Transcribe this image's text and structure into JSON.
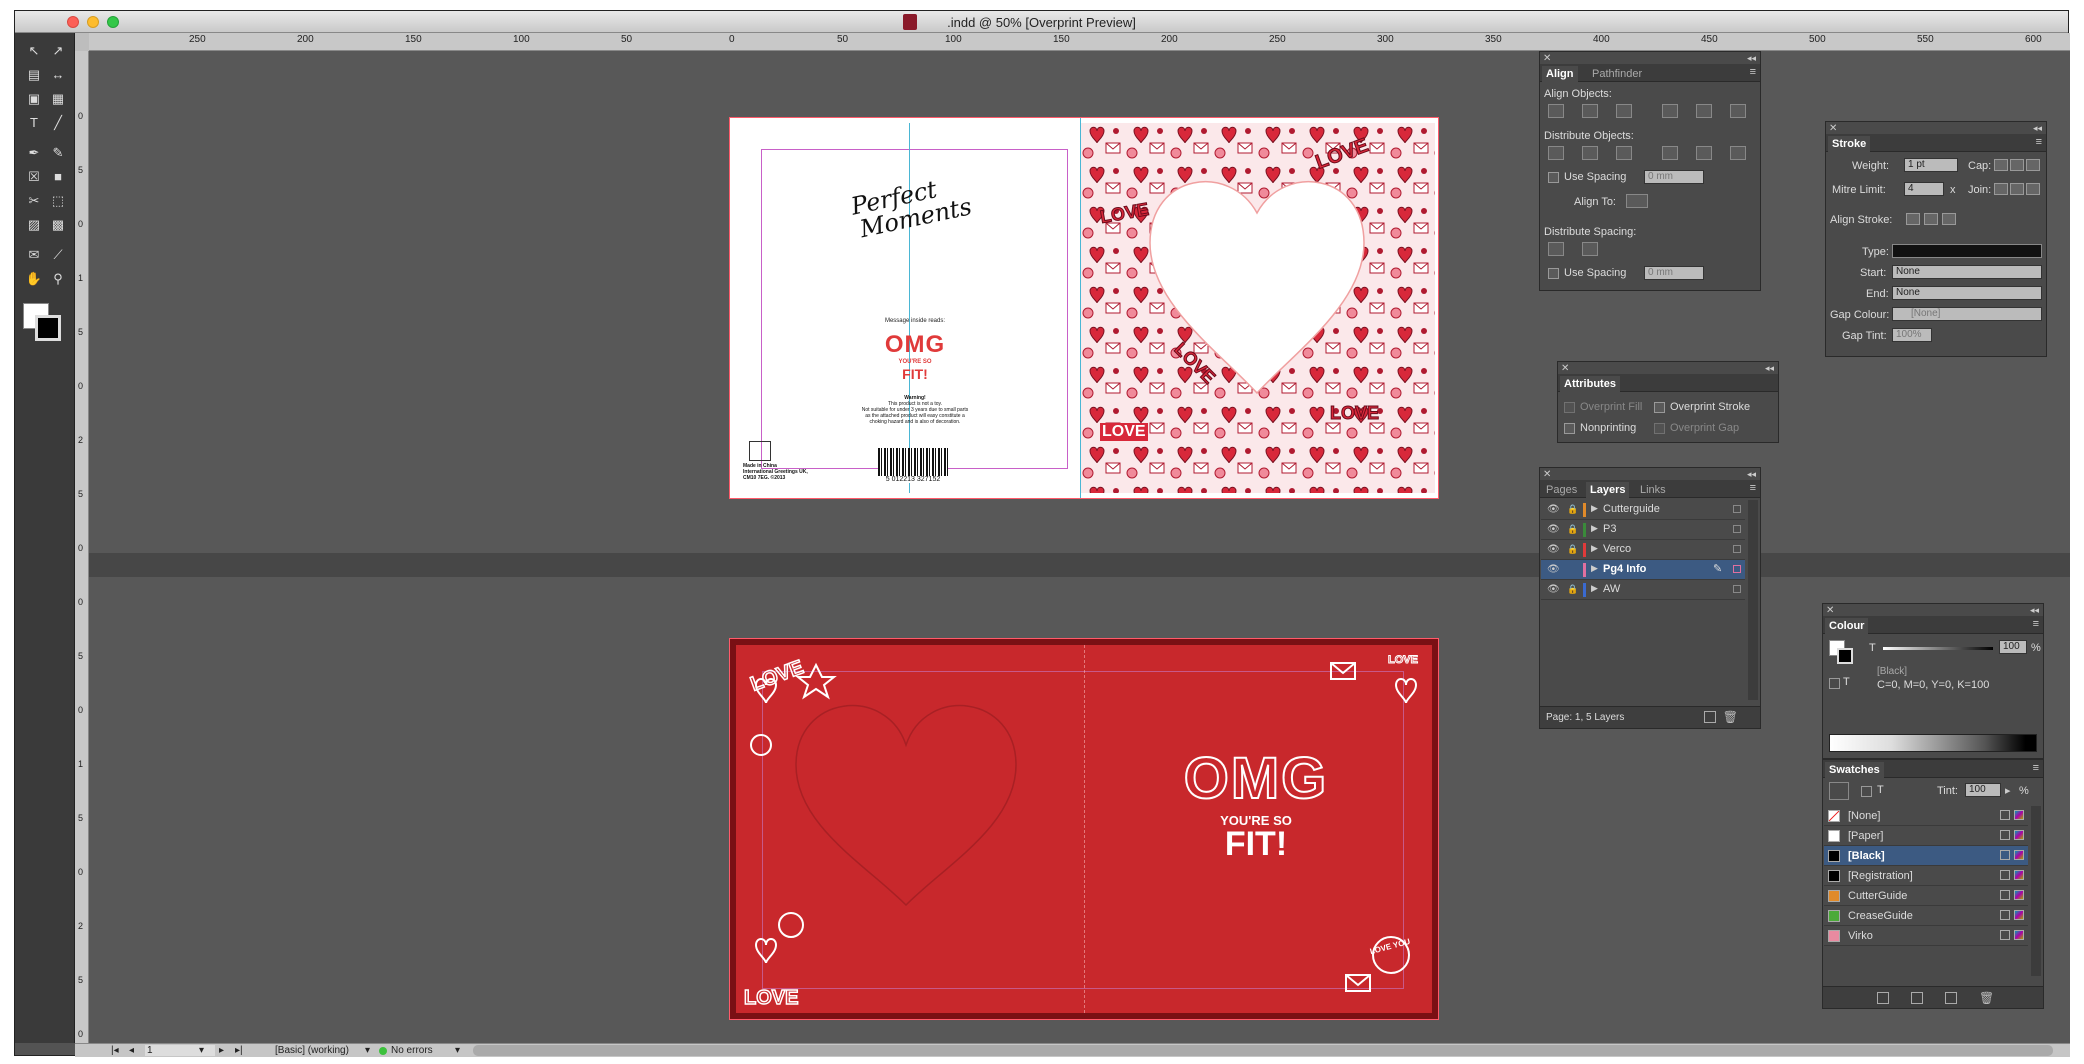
{
  "window": {
    "title": ".indd @ 50% [Overprint Preview]"
  },
  "ruler": {
    "top_ticks": [
      "250",
      "200",
      "150",
      "100",
      "50",
      "0",
      "50",
      "100",
      "150",
      "200",
      "250",
      "300",
      "350",
      "400",
      "450",
      "500",
      "550",
      "600"
    ],
    "left_ticks": [
      "0",
      "5",
      "0",
      "1",
      "5",
      "0",
      "2",
      "5",
      "0",
      "0",
      "5",
      "0",
      "1",
      "5",
      "0",
      "2",
      "5",
      "0"
    ]
  },
  "toolbox": {
    "tools": [
      {
        "name": "selection-tool-icon",
        "glyph": "↖"
      },
      {
        "name": "direct-selection-tool-icon",
        "glyph": "↗"
      },
      {
        "name": "page-tool-icon",
        "glyph": "▤"
      },
      {
        "name": "gap-tool-icon",
        "glyph": "↔"
      },
      {
        "name": "content-collector-icon",
        "glyph": "▣"
      },
      {
        "name": "content-placer-icon",
        "glyph": "▦"
      },
      {
        "name": "type-tool-icon",
        "glyph": "T"
      },
      {
        "name": "line-tool-icon",
        "glyph": "╱"
      },
      {
        "name": "pen-tool-icon",
        "glyph": "✒"
      },
      {
        "name": "pencil-tool-icon",
        "glyph": "✎"
      },
      {
        "name": "rectangle-frame-tool-icon",
        "glyph": "☒"
      },
      {
        "name": "rectangle-tool-icon",
        "glyph": "■"
      },
      {
        "name": "scissors-tool-icon",
        "glyph": "✂"
      },
      {
        "name": "free-transform-tool-icon",
        "glyph": "⬚"
      },
      {
        "name": "gradient-swatch-tool-icon",
        "glyph": "▨"
      },
      {
        "name": "gradient-feather-tool-icon",
        "glyph": "▩"
      },
      {
        "name": "note-tool-icon",
        "glyph": "✉"
      },
      {
        "name": "eyedropper-tool-icon",
        "glyph": "⟋"
      },
      {
        "name": "hand-tool-icon",
        "glyph": "✋"
      },
      {
        "name": "zoom-tool-icon",
        "glyph": "⚲"
      }
    ]
  },
  "statusbar": {
    "page": "1",
    "preflight_profile": "[Basic] (working)",
    "errors": "No errors"
  },
  "align_panel": {
    "tabs": [
      "Align",
      "Pathfinder"
    ],
    "align_objects": "Align Objects:",
    "distribute_objects": "Distribute Objects:",
    "use_spacing": "Use Spacing",
    "spacing_value": "0 mm",
    "align_to": "Align To:",
    "distribute_spacing": "Distribute Spacing:",
    "use_spacing2": "Use Spacing",
    "spacing_value2": "0 mm"
  },
  "stroke_panel": {
    "title": "Stroke",
    "weight_label": "Weight:",
    "weight_value": "1 pt",
    "cap_label": "Cap:",
    "mitre_label": "Mitre Limit:",
    "mitre_value": "4",
    "mitre_x": "x",
    "join_label": "Join:",
    "align_stroke": "Align Stroke:",
    "type_label": "Type:",
    "start_label": "Start:",
    "start_value": "None",
    "end_label": "End:",
    "end_value": "None",
    "gap_colour_label": "Gap Colour:",
    "gap_colour_value": "[None]",
    "gap_tint_label": "Gap Tint:",
    "gap_tint_value": "100%"
  },
  "attributes_panel": {
    "title": "Attributes",
    "overprint_fill": "Overprint Fill",
    "overprint_stroke": "Overprint Stroke",
    "nonprinting": "Nonprinting",
    "overprint_gap": "Overprint Gap"
  },
  "layers_panel": {
    "tabs": [
      "Pages",
      "Layers",
      "Links"
    ],
    "layers": [
      {
        "name": "Cutterguide",
        "color": "#e08a2a",
        "active": false
      },
      {
        "name": "P3",
        "color": "#3a8a3a",
        "active": false
      },
      {
        "name": "Verco",
        "color": "#e03a3a",
        "active": false
      },
      {
        "name": "Pg4 Info",
        "color": "#e070a0",
        "active": true
      },
      {
        "name": "AW",
        "color": "#3a6ad0",
        "active": false
      }
    ],
    "footer": "Page: 1, 5 Layers"
  },
  "colour_panel": {
    "title": "Colour",
    "t_label": "T",
    "tint_value": "100",
    "percent": "%",
    "black_name": "[Black]",
    "cmyk": "C=0, M=0, Y=0, K=100"
  },
  "swatches_panel": {
    "title": "Swatches",
    "tint_label": "Tint:",
    "tint_value": "100",
    "percent": "%",
    "swatches": [
      {
        "name": "[None]",
        "color": "none",
        "selected": false
      },
      {
        "name": "[Paper]",
        "color": "#ffffff",
        "selected": false
      },
      {
        "name": "[Black]",
        "color": "#000000",
        "selected": true
      },
      {
        "name": "[Registration]",
        "color": "#000000",
        "selected": false
      },
      {
        "name": "CutterGuide",
        "color": "#e08a2a",
        "selected": false
      },
      {
        "name": "CreaseGuide",
        "color": "#4caa3a",
        "selected": false
      },
      {
        "name": "Virko",
        "color": "#e88aa0",
        "selected": false
      }
    ]
  },
  "artwork": {
    "brand_line1": "Perfect",
    "brand_line2": "Moments",
    "message_inside": "Message inside reads:",
    "front_omg": "OMG",
    "front_youre_so": "YOU'RE SO",
    "front_fit": "FIT!",
    "warning_title": "Warning!",
    "warning_l1": "This product is not a toy.",
    "warning_l2": "Not suitable for under 3 years due to small parts",
    "warning_l3": "as the attached product will easy constitute a",
    "warning_l4": "choking hazard and is also of decoration.",
    "barcode": "5 012213 327152",
    "publisher_l1": "Made in China",
    "publisher_l2": "International Greetings UK,",
    "publisher_l3": "CM10 7EG. ©2013",
    "love_word": "LOVE",
    "inside_omg": "OMG",
    "inside_youre_so": "YOU'RE SO",
    "inside_fit": "FIT!",
    "love_you_badge": "LOVE YOU"
  }
}
